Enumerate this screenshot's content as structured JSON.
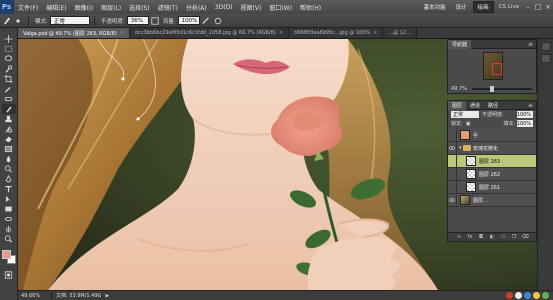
{
  "app": {
    "logo": "Ps"
  },
  "menu": {
    "items": [
      "文件(F)",
      "编辑(E)",
      "图像(I)",
      "图层(L)",
      "选择(S)",
      "滤镜(T)",
      "分析(A)",
      "3D(D)",
      "视图(V)",
      "窗口(W)",
      "帮助(H)"
    ],
    "workspaces": [
      "基本功能",
      "设计",
      "绘画"
    ],
    "active_workspace": "绘画",
    "cs_live": "CS Live"
  },
  "options": {
    "mode_label": "模式:",
    "mode_value": "正常",
    "opacity_label": "不透明度:",
    "opacity_value": "36%",
    "flow_label": "流量:",
    "flow_value": "100%"
  },
  "doc_tabs": [
    {
      "label": "Valga.psd @ 49.7% (图层 263, RGB/8)",
      "active": true
    },
    {
      "label": "dcc3bb6bc29e0f0d1c6c1fdd_1058.jpg @ 66.7% (RGB/8)",
      "active": false
    },
    {
      "label": "b66f0f3ea6b95c...jpg @ 100%",
      "active": false
    },
    {
      "label": "...@ 12...",
      "active": false
    }
  ],
  "status": {
    "zoom": "49.66%",
    "doc": "文档: 33.9M/1.49G",
    "arrow": "▶"
  },
  "navigator": {
    "tabs": [
      "导航器"
    ],
    "zoom": "49.7%"
  },
  "layers_panel": {
    "tabs": [
      "图层",
      "通道",
      "路径"
    ],
    "blend_mode": "正常",
    "opacity_label": "不透明度:",
    "opacity_value": "100%",
    "lock_label": "锁定:",
    "fill_label": "填充:",
    "fill_value": "100%",
    "layers": [
      {
        "name": "手",
        "thumb": "orange",
        "type": "layer",
        "visible": false,
        "selected": false,
        "indent": false
      },
      {
        "name": "玫瑰花微化",
        "thumb": "none",
        "type": "group",
        "visible": true,
        "selected": false,
        "indent": false
      },
      {
        "name": "图层 263",
        "thumb": "checker",
        "type": "layer",
        "visible": false,
        "selected": true,
        "indent": true
      },
      {
        "name": "图层 262",
        "thumb": "checker",
        "type": "layer",
        "visible": false,
        "selected": false,
        "indent": true
      },
      {
        "name": "图层 261",
        "thumb": "checker",
        "type": "layer",
        "visible": false,
        "selected": false,
        "indent": true
      },
      {
        "name": "图层...",
        "thumb": "photo",
        "type": "layer",
        "visible": true,
        "selected": false,
        "indent": false
      }
    ],
    "footer_icons": [
      "link-icon",
      "fx-icon",
      "mask-icon",
      "adjustment-icon",
      "folder-icon",
      "new-layer-icon",
      "trash-icon"
    ]
  },
  "colors": {
    "foreground": "#e89a86",
    "background": "#ffffff",
    "selected_layer": "#b9c87a"
  }
}
